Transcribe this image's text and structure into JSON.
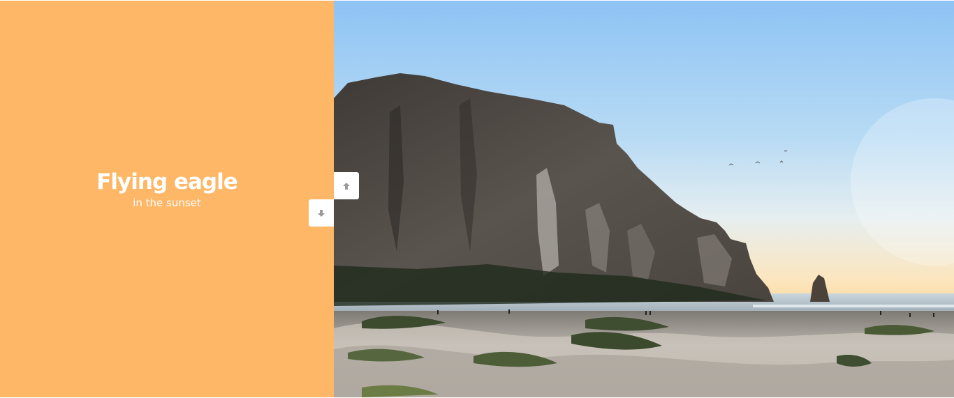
{
  "slide": {
    "title": "Flying eagle",
    "subtitle": "in the sunset",
    "panel_color": "#fdb766",
    "image_description_icon": "photo-morro-rock"
  },
  "controls": {
    "prev_icon": "arrow-up-icon",
    "next_icon": "arrow-down-icon",
    "icon_color": "#9a9a9a"
  }
}
